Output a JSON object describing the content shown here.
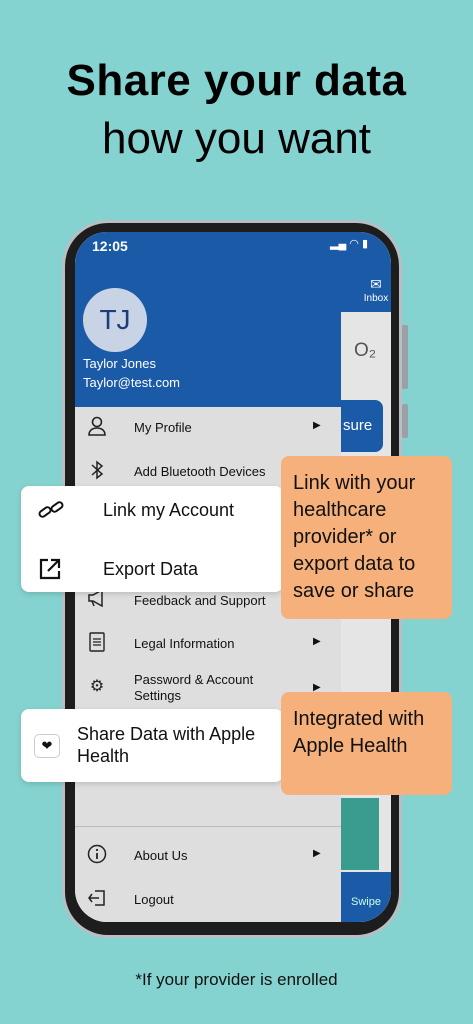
{
  "headline": {
    "line1": "Share your data",
    "line2": "how you want"
  },
  "footnote": "*If your provider is enrolled",
  "status": {
    "time": "12:05",
    "icons": "▂▄ ◠ ▮"
  },
  "app_background": {
    "inbox_label": "Inbox",
    "o2_label": "O₂",
    "button_fragment": "sure",
    "swipe_label": "Swipe"
  },
  "profile": {
    "initials": "TJ",
    "name": "Taylor Jones",
    "email": "Taylor@test.com"
  },
  "menu": {
    "my_profile": "My Profile",
    "add_bluetooth": "Add Bluetooth Devices",
    "feedback": "Feedback and Support",
    "legal": "Legal Information",
    "password": "Password & Account Settings",
    "about": "About Us",
    "logout": "Logout"
  },
  "card_link_export": {
    "link": "Link my Account",
    "export": "Export Data"
  },
  "card_apple": {
    "share": "Share Data with Apple Health"
  },
  "callouts": {
    "healthcare": "Link with your healthcare provider* or export data to save or share",
    "apple": "Integrated with Apple Health"
  },
  "colors": {
    "background": "#85d3d0",
    "brand_blue": "#1b5aa6",
    "callout": "#f5b07b"
  }
}
